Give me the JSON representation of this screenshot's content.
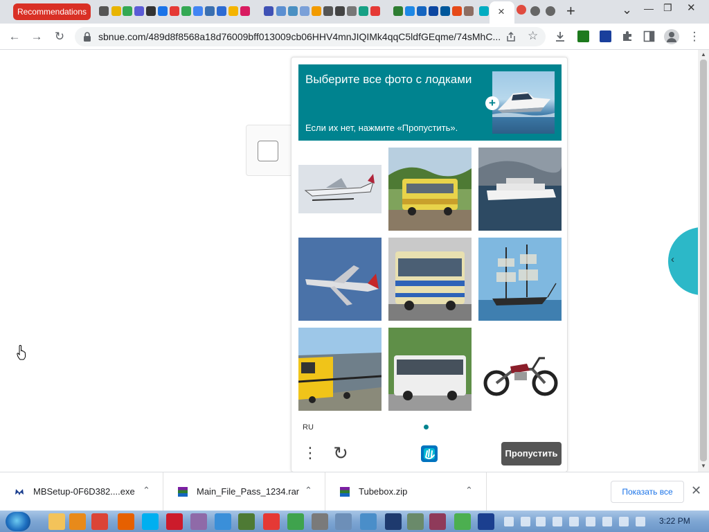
{
  "tabstrip": {
    "recommendations_tab": "Recommendations",
    "close_tab_symbol": "×",
    "new_tab_symbol": "+",
    "tab_list_symbol": "⌄",
    "window_controls": [
      "—",
      "❐",
      "✕"
    ]
  },
  "toolbar": {
    "url": "sbnue.com/489d8f8568a18d76009bff013009cb06HHV4mnJIQIMk4qqC5ldfGEqme/74sMhC...",
    "back_icon": "←",
    "forward_icon": "→",
    "reload_icon": "↻",
    "star_icon": "☆",
    "menu_icon": "⋮"
  },
  "captcha": {
    "prompt_title": "Выберите все фото с лодками",
    "prompt_subtitle": "Если их нет, нажмите «Пропустить».",
    "plus": "+",
    "tiles": [
      {
        "name": "seaplane",
        "row": 0,
        "col": 0
      },
      {
        "name": "bus-yellow",
        "row": 0,
        "col": 1
      },
      {
        "name": "cruise-ship",
        "row": 0,
        "col": 2
      },
      {
        "name": "airplane",
        "row": 1,
        "col": 0
      },
      {
        "name": "bus-blue",
        "row": 1,
        "col": 1
      },
      {
        "name": "sailing-ship",
        "row": 1,
        "col": 2
      },
      {
        "name": "train",
        "row": 2,
        "col": 0
      },
      {
        "name": "bus-white",
        "row": 2,
        "col": 1
      },
      {
        "name": "motorcycle",
        "row": 2,
        "col": 2
      }
    ],
    "language": "RU",
    "menu_dots": "⋮",
    "refresh_icon": "↻",
    "skip_label": "Пропустить"
  },
  "sidebar_chevron": "‹",
  "downloads": {
    "items": [
      {
        "name": "MBSetup-0F6D382....exe"
      },
      {
        "name": "Main_File_Pass_1234.rar"
      },
      {
        "name": "Tubebox.zip"
      }
    ],
    "chevron": "⌃",
    "show_all": "Показать все",
    "close": "✕"
  },
  "taskbar": {
    "clock": "3:22 PM"
  },
  "colors": {
    "accent": "#00838f",
    "recommendations_tab": "#d93025",
    "sidebar_circle": "#2cb8c8"
  }
}
